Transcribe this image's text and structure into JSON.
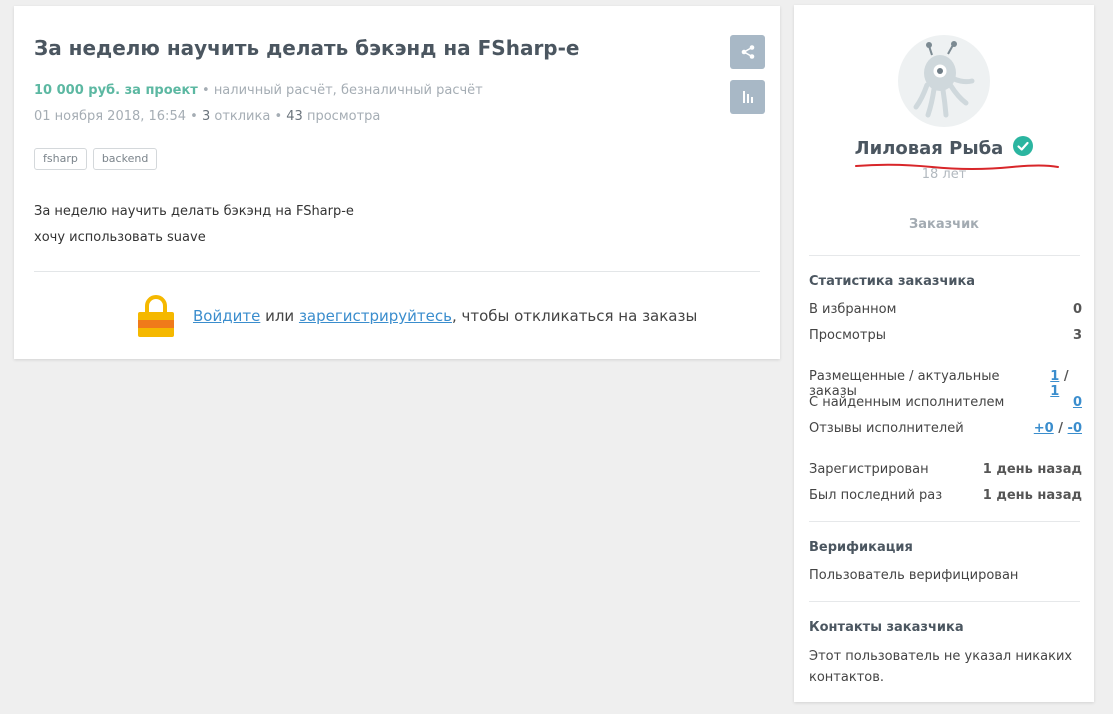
{
  "task": {
    "title": "За неделю научить делать бэкэнд на FSharp-е",
    "price": "10 000 руб. за проект",
    "payment": "наличный расчёт, безналичный расчёт",
    "date": "01 ноября 2018, 16:54",
    "responses_count": "3",
    "responses_label": "отклика",
    "views_count": "43",
    "views_label": "просмотра",
    "bullet": "•",
    "tags": [
      "fsharp",
      "backend"
    ],
    "description_lines": [
      "За неделю научить делать бэкэнд на FSharp-е",
      "хочу использовать suave"
    ],
    "login": {
      "login_link": "Войдите",
      "or": " или ",
      "register_link": "зарегистрируйтесь",
      "suffix": ", чтобы откликаться на заказы"
    }
  },
  "icons": {
    "share": "share-icon",
    "stats": "stats-icon",
    "lock": "lock-icon",
    "verified": "verified-check-icon",
    "avatar": "octopus-avatar-icon"
  },
  "colors": {
    "price": "#5cb8a2",
    "link": "#3a8dcd",
    "button": "#a8b8c6",
    "verified": "#2bb5a0",
    "scribble": "#d8262a",
    "lock_body": "#f5b800",
    "lock_stripe": "#f07a1a"
  },
  "sidebar": {
    "name": "Лиловая Рыба",
    "age": "18 лет",
    "role": "Заказчик",
    "stats_title": "Статистика заказчика",
    "favorites_label": "В избранном",
    "favorites_value": "0",
    "views_label": "Просмотры",
    "views_value": "3",
    "orders_label": "Размещенные / актуальные заказы",
    "orders_placed": "1",
    "orders_sep": " / ",
    "orders_active": "1",
    "with_performer_label": "С найденным исполнителем",
    "with_performer_value": "0",
    "reviews_label": "Отзывы исполнителей",
    "reviews_positive": "+0",
    "reviews_sep": " / ",
    "reviews_negative": "-0",
    "registered_label": "Зарегистрирован",
    "registered_value": "1 день назад",
    "last_seen_label": "Был последний раз",
    "last_seen_value": "1 день назад",
    "verification_title": "Верификация",
    "verification_text": "Пользователь верифицирован",
    "contacts_title": "Контакты заказчика",
    "contacts_text": "Этот пользователь не указал никаких контактов."
  }
}
